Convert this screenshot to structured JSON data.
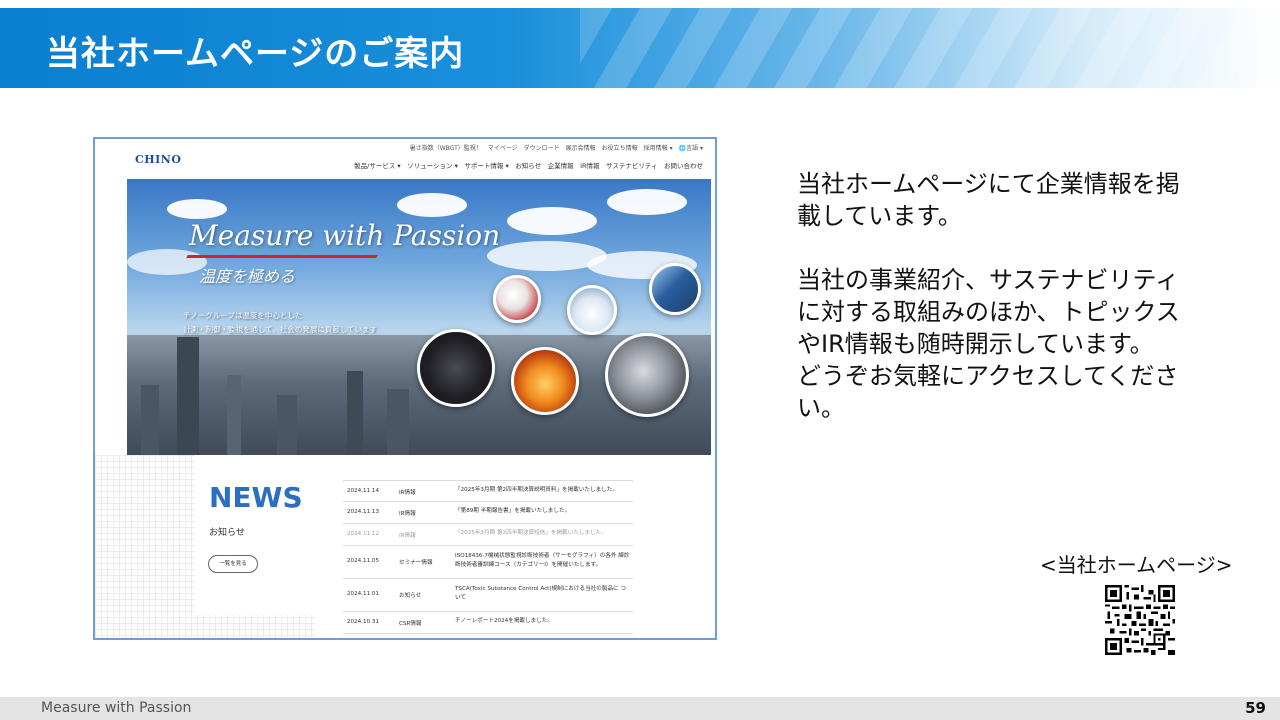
{
  "title": "当社ホームページのご案内",
  "website": {
    "utility_nav": "暑さ指数（WBGT）監視！　マイページ　ダウンロード　展示会情報　お役立ち情報　採用情報 ▾　🌐言語 ▾",
    "logo": "CHINO",
    "main_nav": "製品/サービス ▾　ソリューション ▾　サポート情報 ▾　お知らせ　企業情報　IR情報　サステナビリティ　お問い合わせ",
    "hero": {
      "slogan": "Measure with Passion",
      "subslogan": "温度を極める",
      "description_line1": "チノーグループは温度を中心とした",
      "description_line2": "計測・制御・監視を通して、社会の発展に貢献しています"
    },
    "news": {
      "title": "NEWS",
      "subtitle": "お知らせ",
      "more_button": "一覧を見る",
      "items": [
        {
          "date": "2024.11.14",
          "category": "IR情報",
          "text": "「2025年3月期 第2四半期決算説明資料」を掲載いたしました。"
        },
        {
          "date": "2024.11.13",
          "category": "IR情報",
          "text": "「第89期 半期報告書」を掲載いたしました。"
        },
        {
          "date": "2024.11.12",
          "category": "IR情報",
          "text": "「2025年3月期 第2四半期決算短信」を掲載いたしました。"
        },
        {
          "date": "2024.11.05",
          "category": "セミナー情報",
          "text": "ISO18436-7機械状態監視診断技術者（サーモグラフィ）の各外 練診断技術者審訓練コース（カテゴリーⅠ）を開催いたします。"
        },
        {
          "date": "2024.11.01",
          "category": "お知らせ",
          "text": "TSCA(Toxic Substance Control Act)規制における当社の製品に ついて"
        },
        {
          "date": "2024.10.31",
          "category": "CSR情報",
          "text": "チノーレポート2024を掲載しました。"
        }
      ]
    }
  },
  "body": {
    "para1": "当社ホームページにて企業情報を掲載しています。",
    "para2": "当社の事業紹介、サステナビリティに対する取組みのほか、トピックスやIR情報も随時開示しています。",
    "para3": "どうぞお気軽にアクセスしてください。"
  },
  "homepage_label": "<当社ホームページ>",
  "footer": {
    "slogan": "Measure with Passion",
    "page_number": "59"
  }
}
